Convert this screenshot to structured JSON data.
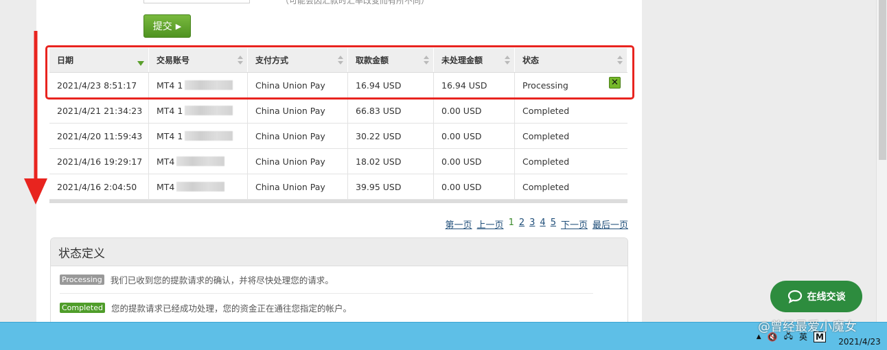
{
  "form": {
    "hint": "（可能会因汇款时汇率改变而有所不同）",
    "submit_label": "提交"
  },
  "table": {
    "columns": [
      "日期",
      "交易账号",
      "支付方式",
      "取款金额",
      "未处理金额",
      "状态"
    ],
    "rows": [
      {
        "date": "2021/4/23 8:51:17",
        "account": "MT4 1",
        "method": "China Union Pay",
        "amount": "16.94 USD",
        "pending": "16.94 USD",
        "status": "Processing"
      },
      {
        "date": "2021/4/21 21:34:23",
        "account": "MT4 1",
        "method": "China Union Pay",
        "amount": "66.83 USD",
        "pending": "0.00 USD",
        "status": "Completed"
      },
      {
        "date": "2021/4/20 11:59:43",
        "account": "MT4 1",
        "method": "China Union Pay",
        "amount": "30.22 USD",
        "pending": "0.00 USD",
        "status": "Completed"
      },
      {
        "date": "2021/4/16 19:29:17",
        "account": "MT4",
        "method": "China Union Pay",
        "amount": "18.02 USD",
        "pending": "0.00 USD",
        "status": "Completed"
      },
      {
        "date": "2021/4/16 2:04:50",
        "account": "MT4",
        "method": "China Union Pay",
        "amount": "39.95 USD",
        "pending": "0.00 USD",
        "status": "Completed"
      }
    ]
  },
  "pager": {
    "first": "第一页",
    "prev": "上一页",
    "pages": [
      "1",
      "2",
      "3",
      "4",
      "5"
    ],
    "current": "1",
    "next": "下一页",
    "last": "最后一页"
  },
  "status_def": {
    "title": "状态定义",
    "items": [
      {
        "badge": "Processing",
        "text": "我们已收到您的提款请求的确认，并将尽快处理您的请求。"
      },
      {
        "badge": "Completed",
        "text": "您的提款请求已经成功处理，您的资金正在通往您指定的帐户。"
      }
    ]
  },
  "chat": {
    "label": "在线交谈"
  },
  "taskbar": {
    "ime": "英",
    "m": "M",
    "date": "2021/4/23"
  },
  "watermark": "@曾经最爱小魔女",
  "colors": {
    "highlight": "#e8241f",
    "accent_green": "#4f9321",
    "chat_green": "#2d8c3e",
    "taskbar": "#5ebfe7"
  }
}
